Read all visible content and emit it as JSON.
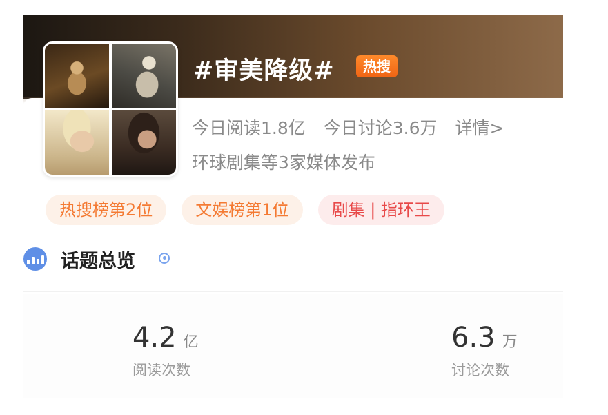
{
  "topic": {
    "title": "#审美降级#",
    "badge": "热搜"
  },
  "stats": {
    "read_today": "今日阅读1.8亿",
    "discuss_today": "今日讨论3.6万",
    "detail_link": "详情>",
    "media": "环球剧集等3家媒体发布"
  },
  "tags": [
    {
      "label": "热搜榜第2位"
    },
    {
      "label": "文娱榜第1位"
    },
    {
      "label": "剧集 | 指环王"
    }
  ],
  "overview": {
    "title": "话题总览",
    "icon": "chart-icon",
    "metrics": [
      {
        "value": "4.2",
        "unit": "亿",
        "label": "阅读次数"
      },
      {
        "value": "6.3",
        "unit": "万",
        "label": "讨论次数"
      }
    ]
  },
  "colors": {
    "badge_orange": "#f06414",
    "tag_orange": "#f47a33",
    "tag_red": "#e84a4a",
    "accent_blue": "#5f8fe6"
  }
}
